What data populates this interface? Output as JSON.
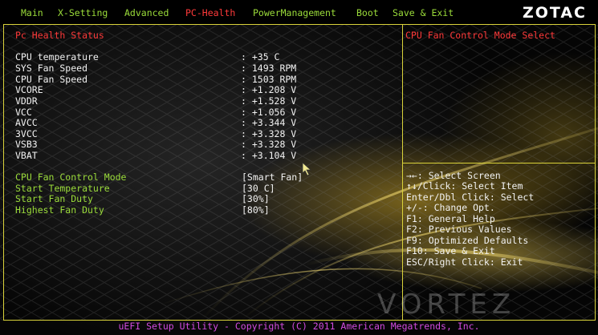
{
  "menu": {
    "items": [
      "Main",
      "X-Setting",
      "Advanced",
      "PC-Health",
      "PowerManagement",
      "Boot",
      "Save & Exit"
    ],
    "active_index": 3,
    "logo": "ZOTAC"
  },
  "health": {
    "section_title": "Pc Health Status",
    "readings": [
      {
        "label": "CPU temperature",
        "value": ": +35 C"
      },
      {
        "label": "SYS Fan Speed",
        "value": ": 1493 RPM"
      },
      {
        "label": "CPU Fan Speed",
        "value": ": 1503 RPM"
      },
      {
        "label": "VCORE",
        "value": ": +1.208 V"
      },
      {
        "label": "VDDR",
        "value": ": +1.528 V"
      },
      {
        "label": "VCC",
        "value": ": +1.056 V"
      },
      {
        "label": "AVCC",
        "value": ": +3.344 V"
      },
      {
        "label": "3VCC",
        "value": ": +3.328 V"
      },
      {
        "label": "VSB3",
        "value": ": +3.328 V"
      },
      {
        "label": "VBAT",
        "value": ": +3.104 V"
      }
    ],
    "settings": [
      {
        "label": "CPU Fan Control Mode",
        "value": "[Smart Fan]"
      },
      {
        "label": "Start Temperature",
        "value": "[30 C]"
      },
      {
        "label": "Start Fan Duty",
        "value": "[30%]"
      },
      {
        "label": "Highest Fan Duty",
        "value": "[80%]"
      }
    ]
  },
  "side": {
    "description": "CPU Fan Control Mode Select",
    "help": [
      "→←: Select Screen",
      "↑↓/Click: Select Item",
      "Enter/Dbl Click: Select",
      "+/-: Change Opt.",
      "F1: General Help",
      "F2: Previous Values",
      "F9: Optimized Defaults",
      "F10: Save & Exit",
      "ESC/Right Click: Exit"
    ]
  },
  "footer": "uEFI Setup Utility - Copyright (C) 2011 American Megatrends, Inc.",
  "watermark": "VORTEZ",
  "colors": {
    "menu_text": "#9bdc3a",
    "menu_active": "#ff3a3a",
    "frame": "#d9d23a",
    "footer": "#d24be0"
  }
}
